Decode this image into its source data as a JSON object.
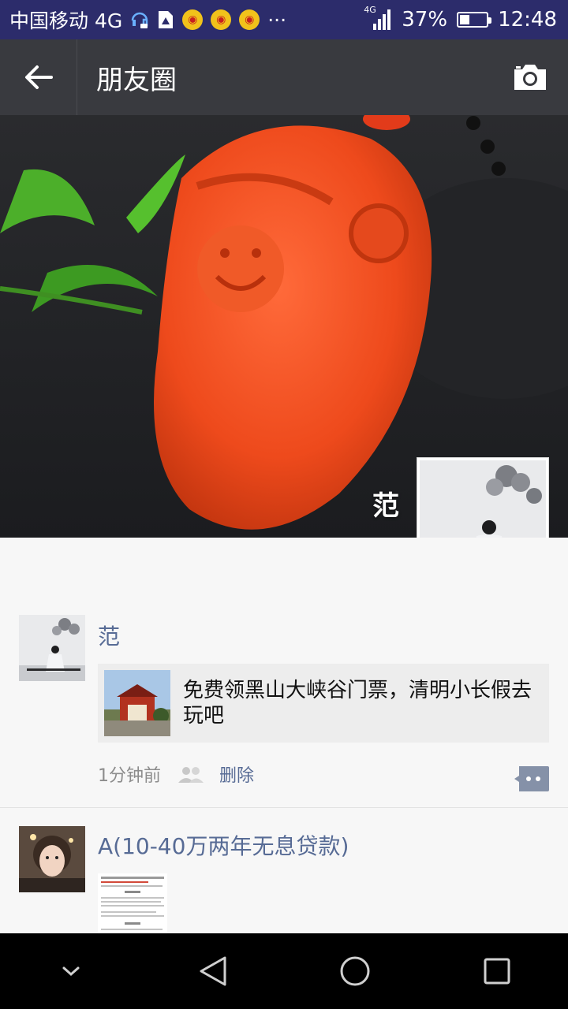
{
  "status_bar": {
    "carrier": "中国移动 4G",
    "network": "4G",
    "battery_percent": "37%",
    "battery_level": 0.37,
    "time": "12:48",
    "more": "···"
  },
  "topbar": {
    "title": "朋友圈"
  },
  "profile": {
    "name": "范"
  },
  "posts": [
    {
      "nickname": "范",
      "link_text": "免费领黑山大峡谷门票，清明小长假去玩吧",
      "time": "1分钟前",
      "delete_label": "删除"
    },
    {
      "nickname": "A(10-40万两年无息贷款)"
    }
  ],
  "icons": {
    "back": "arrow-left-icon",
    "camera": "camera-icon",
    "people": "people-icon",
    "comment": "comment-icon"
  },
  "colors": {
    "status_bar": "#2c2c6b",
    "topbar": "#393a3f",
    "link_blue": "#576b95",
    "feed_bg": "#f7f7f7"
  }
}
